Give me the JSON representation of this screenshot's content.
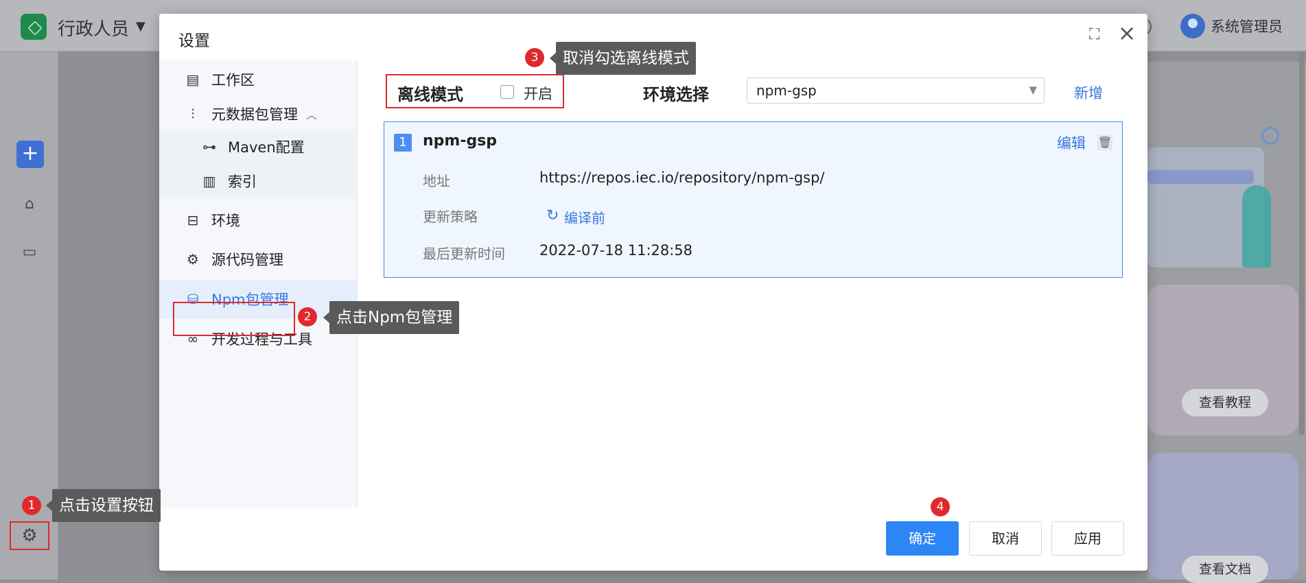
{
  "app": {
    "title": "行政人员",
    "caret": "▼",
    "user": "系统管理员"
  },
  "background": {
    "plus": "+",
    "pill_tutorial": "查看教程",
    "pill_docs": "查看文档"
  },
  "dialog": {
    "title": "设置",
    "expand_icon": "⛶",
    "close_icon": "×",
    "sidebar": [
      {
        "label": "工作区",
        "icon": "workspace-icon",
        "glyph": "▤"
      },
      {
        "label": "元数据包管理",
        "icon": "sliders-icon",
        "glyph": "⫶",
        "expanded": true,
        "caret": "︿"
      },
      {
        "label": "Maven配置",
        "icon": "share-nodes-icon",
        "glyph": "⊶"
      },
      {
        "label": "索引",
        "icon": "index-icon",
        "glyph": "▥"
      },
      {
        "label": "环境",
        "icon": "folder-tree-icon",
        "glyph": "⊟"
      },
      {
        "label": "源代码管理",
        "icon": "gear-icon",
        "glyph": "⚙"
      },
      {
        "label": "Npm包管理",
        "icon": "database-icon",
        "glyph": "⛁"
      },
      {
        "label": "开发过程与工具",
        "icon": "infinity-icon",
        "glyph": "∞"
      }
    ],
    "offline_mode_label": "离线模式",
    "offline_checkbox_label": "开启",
    "offline_checked": false,
    "env_label": "环境选择",
    "env_value": "npm-gsp",
    "env_caret": "▼",
    "add_label": "新增",
    "repo": {
      "index": "1",
      "name": "npm-gsp",
      "edit_label": "编辑",
      "trash_glyph": "🗑",
      "address_key": "地址",
      "address_value": "https://repos.iec.io/repository/npm-gsp/",
      "strategy_key": "更新策略",
      "strategy_value": "编译前",
      "refresh_glyph": "↻",
      "updated_key": "最后更新时间",
      "updated_value": "2022-07-18 11:28:58"
    },
    "buttons": {
      "ok": "确定",
      "cancel": "取消",
      "apply": "应用"
    }
  },
  "annotations": [
    {
      "num": "1",
      "text": "点击设置按钮"
    },
    {
      "num": "2",
      "text": "点击Npm包管理"
    },
    {
      "num": "3",
      "text": "取消勾选离线模式"
    },
    {
      "num": "4",
      "text": ""
    }
  ],
  "colors": {
    "accent": "#2d86f5",
    "link": "#3a76e0",
    "annotation_red": "#e0292b",
    "tooltip_bg": "#5a5a5a"
  }
}
